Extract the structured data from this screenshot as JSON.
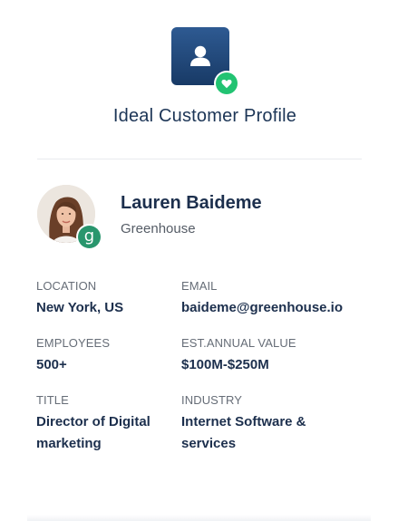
{
  "header": {
    "icon": "user-icon",
    "badge_icon": "heart-icon",
    "title": "Ideal Customer Profile"
  },
  "profile": {
    "name": "Lauren Baideme",
    "company": "Greenhouse",
    "company_badge_letter": "g",
    "company_badge_color": "#29966d",
    "accent_heart_color": "#22c372"
  },
  "fields": {
    "location": {
      "label": "LOCATION",
      "value": "New York, US"
    },
    "email": {
      "label": "EMAIL",
      "value": "baideme@greenhouse.io"
    },
    "employees": {
      "label": "EMPLOYEES",
      "value": "500+"
    },
    "annual_value": {
      "label": "EST.ANNUAL VALUE",
      "value": "$100M-$250M"
    },
    "title": {
      "label": "TITLE",
      "value": "Director of Digital marketing"
    },
    "industry": {
      "label": "INDUSTRY",
      "value": "Internet Software & services"
    }
  }
}
